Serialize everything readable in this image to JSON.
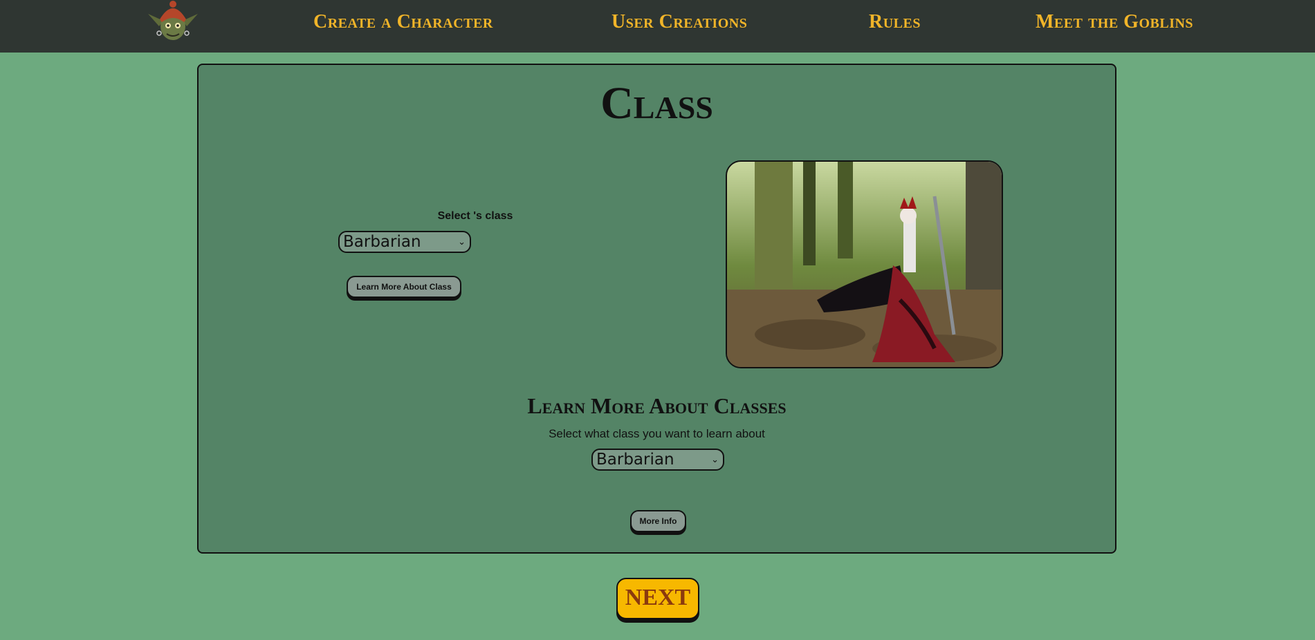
{
  "nav": {
    "logo_icon": "goblin-logo-icon",
    "links": [
      {
        "label": "Create a Character"
      },
      {
        "label": "User Creations"
      },
      {
        "label": "Rules"
      },
      {
        "label": "Meet the Goblins"
      }
    ]
  },
  "panel": {
    "title": "Class",
    "select_label": "Select 's class",
    "class_select_value": "Barbarian",
    "learn_button_label": "Learn More About Class",
    "image_icon": "barbarian-queen-photo",
    "section_title": "Learn More About Classes",
    "section_subtitle": "Select what class you want to learn about",
    "info_select_value": "Barbarian",
    "info_button_label": "More Info"
  },
  "next_label": "NEXT",
  "colors": {
    "background": "#6daa7f",
    "navbar": "#2f3632",
    "nav_text": "#f0b429",
    "panel": "#548466",
    "next_button": "#f7b800"
  }
}
